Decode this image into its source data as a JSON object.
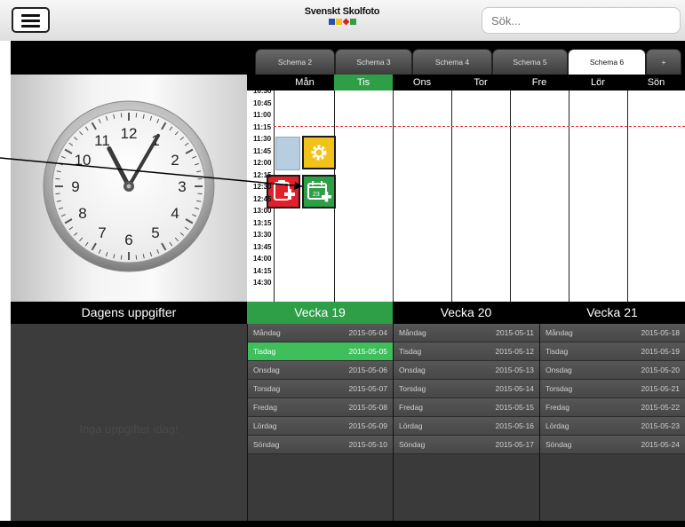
{
  "header": {
    "brand": "Svenskt Skolfoto",
    "search_placeholder": "Sök..."
  },
  "tabs": [
    {
      "label": "Schema 2",
      "active": false
    },
    {
      "label": "Schema 3",
      "active": false
    },
    {
      "label": "Schema 4",
      "active": false
    },
    {
      "label": "Schema 5",
      "active": false
    },
    {
      "label": "Schema 6",
      "active": true
    },
    {
      "label": "+",
      "active": false
    }
  ],
  "clock": {
    "numbers": [
      "12",
      "1",
      "2",
      "3",
      "4",
      "5",
      "6",
      "7",
      "8",
      "9",
      "10",
      "11"
    ],
    "time": "11:05"
  },
  "schedule": {
    "days": [
      {
        "label": "Mån",
        "active": false
      },
      {
        "label": "Tis",
        "active": true
      },
      {
        "label": "Ons",
        "active": false
      },
      {
        "label": "Tor",
        "active": false
      },
      {
        "label": "Fre",
        "active": false
      },
      {
        "label": "Lör",
        "active": false
      },
      {
        "label": "Sön",
        "active": false
      }
    ],
    "times": [
      "10:30",
      "10:45",
      "11:00",
      "11:15",
      "11:30",
      "11:45",
      "12:00",
      "12:15",
      "12:30",
      "12:45",
      "13:00",
      "13:15",
      "13:30",
      "13:45",
      "14:00",
      "14:15",
      "14:30"
    ],
    "calendar_day": "23"
  },
  "tasks": {
    "title": "Dagens uppgifter",
    "empty_text": "Inga uppgifter idag!"
  },
  "weeks": [
    {
      "label": "Vecka 19",
      "active": true,
      "rows": [
        {
          "day": "Måndag",
          "date": "2015-05-04",
          "active": false
        },
        {
          "day": "Tisdag",
          "date": "2015-05-05",
          "active": true
        },
        {
          "day": "Onsdag",
          "date": "2015-05-06",
          "active": false
        },
        {
          "day": "Torsdag",
          "date": "2015-05-07",
          "active": false
        },
        {
          "day": "Fredag",
          "date": "2015-05-08",
          "active": false
        },
        {
          "day": "Lördag",
          "date": "2015-05-09",
          "active": false
        },
        {
          "day": "Söndag",
          "date": "2015-05-10",
          "active": false
        }
      ]
    },
    {
      "label": "Vecka 20",
      "active": false,
      "rows": [
        {
          "day": "Måndag",
          "date": "2015-05-11",
          "active": false
        },
        {
          "day": "Tisdag",
          "date": "2015-05-12",
          "active": false
        },
        {
          "day": "Onsdag",
          "date": "2015-05-13",
          "active": false
        },
        {
          "day": "Torsdag",
          "date": "2015-05-14",
          "active": false
        },
        {
          "day": "Fredag",
          "date": "2015-05-15",
          "active": false
        },
        {
          "day": "Lördag",
          "date": "2015-05-16",
          "active": false
        },
        {
          "day": "Söndag",
          "date": "2015-05-17",
          "active": false
        }
      ]
    },
    {
      "label": "Vecka 21",
      "active": false,
      "rows": [
        {
          "day": "Måndag",
          "date": "2015-05-18",
          "active": false
        },
        {
          "day": "Tisdag",
          "date": "2015-05-19",
          "active": false
        },
        {
          "day": "Onsdag",
          "date": "2015-05-20",
          "active": false
        },
        {
          "day": "Torsdag",
          "date": "2015-05-21",
          "active": false
        },
        {
          "day": "Fredag",
          "date": "2015-05-22",
          "active": false
        },
        {
          "day": "Lördag",
          "date": "2015-05-23",
          "active": false
        },
        {
          "day": "Söndag",
          "date": "2015-05-24",
          "active": false
        }
      ]
    }
  ],
  "colors": {
    "green": "#2e9e47",
    "red": "#e0202a",
    "yellow": "#f2c21a",
    "blue_block": "#b7cde0"
  }
}
